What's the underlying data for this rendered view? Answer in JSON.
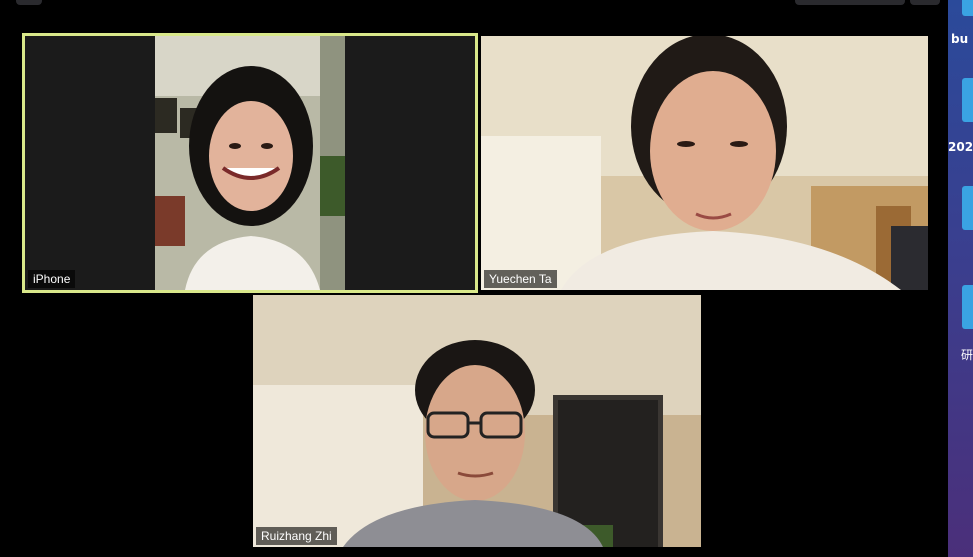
{
  "participants": [
    {
      "name": "iPhone",
      "active": true
    },
    {
      "name": "Yuechen Ta",
      "active": false
    },
    {
      "name": "Ruizhang Zhi",
      "active": false
    }
  ],
  "desktop": {
    "items": [
      {
        "label": "bu"
      },
      {
        "label": "202"
      },
      {
        "label": ""
      },
      {
        "label": "研"
      }
    ]
  },
  "colors": {
    "active_border": "#d9e88a",
    "background": "#000000",
    "folder": "#3aa3e3"
  }
}
